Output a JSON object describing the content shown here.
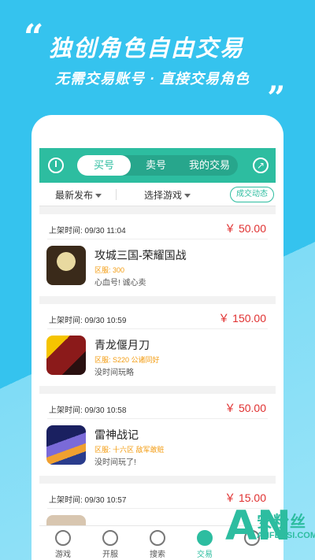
{
  "promo": {
    "quote_open": "“",
    "headline": "独创角色自由交易",
    "subline": "无需交易账号 · 直接交易角色",
    "quote_close": "„"
  },
  "topbar": {
    "tabs": [
      {
        "label": "买号",
        "active": true
      },
      {
        "label": "卖号",
        "active": false
      },
      {
        "label": "我的交易",
        "active": false
      }
    ]
  },
  "filters": {
    "sort_label": "最新发布",
    "game_label": "选择游戏",
    "deal_button": "成交动态"
  },
  "listings": [
    {
      "time": "上架时间: 09/30 11:04",
      "price": "￥ 50.00",
      "title": "攻城三国-荣耀国战",
      "server": "区服: 300",
      "desc": "心血号! 诚心卖",
      "thumb_color": "#3a2a1a"
    },
    {
      "time": "上架时间: 09/30 10:59",
      "price": "￥ 150.00",
      "title": "青龙偃月刀",
      "server": "区服: S220 公诸同好",
      "desc": "没时间玩略",
      "thumb_color": "#8b1a1a"
    },
    {
      "time": "上架时间: 09/30 10:58",
      "price": "￥ 50.00",
      "title": "雷神战记",
      "server": "区服: 十六区 敌军敢赃",
      "desc": "没时间玩了!",
      "thumb_color": "#2a3c8c"
    },
    {
      "time": "上架时间: 09/30 10:57",
      "price": "￥ 15.00",
      "title": "",
      "server": "",
      "desc": "",
      "thumb_color": "#d8c6b0"
    }
  ],
  "bottomnav": [
    {
      "label": "游戏",
      "icon": "pacman-icon",
      "active": false
    },
    {
      "label": "开服",
      "icon": "list-icon",
      "active": false
    },
    {
      "label": "搜索",
      "icon": "search-icon",
      "active": false
    },
    {
      "label": "交易",
      "icon": "trade-icon",
      "active": true
    },
    {
      "label": "",
      "icon": "user-icon",
      "active": false
    }
  ],
  "watermark": {
    "logo": "AN",
    "cn": "安粉丝",
    "en": "ANFENSI.COM"
  },
  "colors": {
    "accent": "#2dbda0",
    "price": "#e03030",
    "background": "#36c6ef"
  }
}
